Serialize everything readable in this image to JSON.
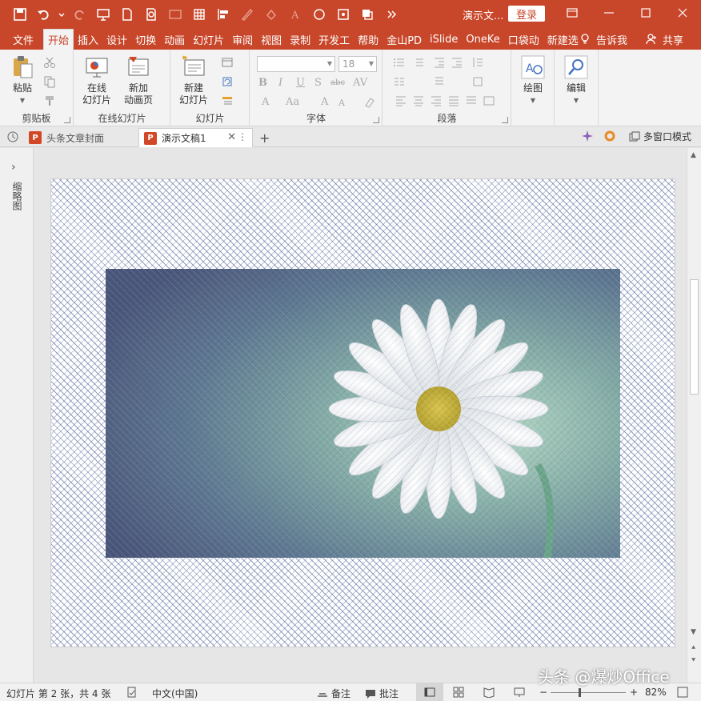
{
  "titlebar": {
    "doc_title": "演示文...",
    "login": "登录",
    "qat_icons": [
      "save-icon",
      "undo-icon",
      "redo-icon",
      "present-icon",
      "new-icon",
      "preview-icon",
      "image-icon",
      "grid-icon",
      "align-icon",
      "pen-icon",
      "fill-icon",
      "font-color-icon",
      "circle-icon",
      "crop-icon",
      "layers-icon",
      "more-icon"
    ]
  },
  "tabs": {
    "file": "文件",
    "items": [
      "开始",
      "插入",
      "设计",
      "切换",
      "动画",
      "幻灯片",
      "审阅",
      "视图",
      "录制",
      "开发工",
      "帮助",
      "金山PD",
      "iSlide",
      "OneKe",
      "口袋动",
      "新建选"
    ],
    "tellme": "告诉我",
    "share": "共享"
  },
  "ribbon": {
    "clipboard": {
      "paste": "粘贴",
      "label": "剪贴板"
    },
    "online": {
      "online_slide_1": "在线",
      "online_slide_2": "幻灯片",
      "new_anim_1": "新加",
      "new_anim_2": "动画页",
      "label": "在线幻灯片"
    },
    "slides": {
      "new_slide_1": "新建",
      "new_slide_2": "幻灯片",
      "label": "幻灯片"
    },
    "font": {
      "font_name": "",
      "font_size": "18",
      "label": "字体"
    },
    "paragraph": {
      "label": "段落"
    },
    "drawing": {
      "label": "绘图"
    },
    "editing": {
      "label": "编辑"
    }
  },
  "doctabs": {
    "tabs": [
      {
        "label": "头条文章封面"
      },
      {
        "label": "演示文稿1"
      }
    ],
    "add": "+",
    "multiwindow": "多窗口模式"
  },
  "leftpane": {
    "label": "缩略图"
  },
  "statusbar": {
    "slide_info": "幻灯片 第 2 张，共 4 张",
    "language": "中文(中国)",
    "notes": "备注",
    "comments": "批注",
    "zoom_minus": "−",
    "zoom_plus": "+",
    "zoom": "82%"
  },
  "watermark": "头条 @爆炒Office",
  "colors": {
    "accent": "#c8462a",
    "ribbon_bg": "#f3f3f3",
    "status_bg": "#f1f1f1"
  }
}
